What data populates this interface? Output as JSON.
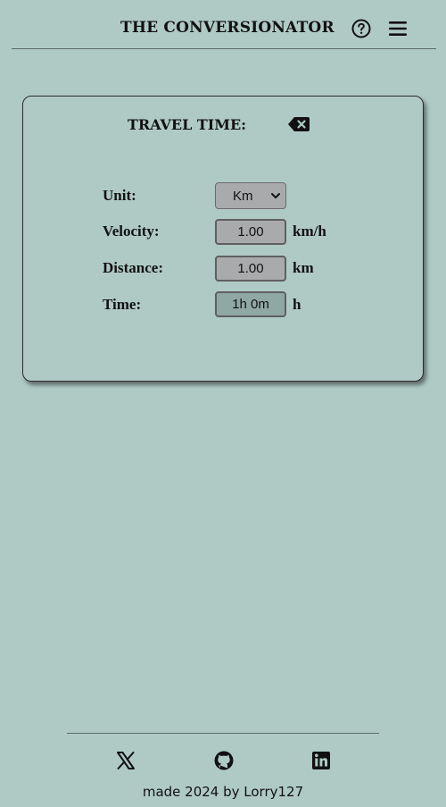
{
  "header": {
    "title": "THE CONVERSIONATOR",
    "help_icon": "question-circle-icon",
    "menu_icon": "hamburger-menu-icon"
  },
  "card": {
    "title": "TRAVEL TIME:",
    "clear_icon": "backspace-icon",
    "rows": {
      "unit": {
        "label": "Unit:",
        "selected": "Km"
      },
      "velocity": {
        "label": "Velocity:",
        "value": "1.00",
        "unit": "km/h"
      },
      "distance": {
        "label": "Distance:",
        "value": "1.00",
        "unit": "km"
      },
      "time": {
        "label": "Time:",
        "value": "1h 0m",
        "unit": "h"
      }
    }
  },
  "footer": {
    "links": [
      {
        "name": "x-twitter-icon"
      },
      {
        "name": "github-icon"
      },
      {
        "name": "linkedin-icon"
      }
    ],
    "credit": "made 2024 by Lorry127"
  },
  "colors": {
    "background": "#afcac5",
    "field_background": "#a9aaab",
    "readonly_field_background": "#8fa8a3",
    "text": "#111111"
  }
}
